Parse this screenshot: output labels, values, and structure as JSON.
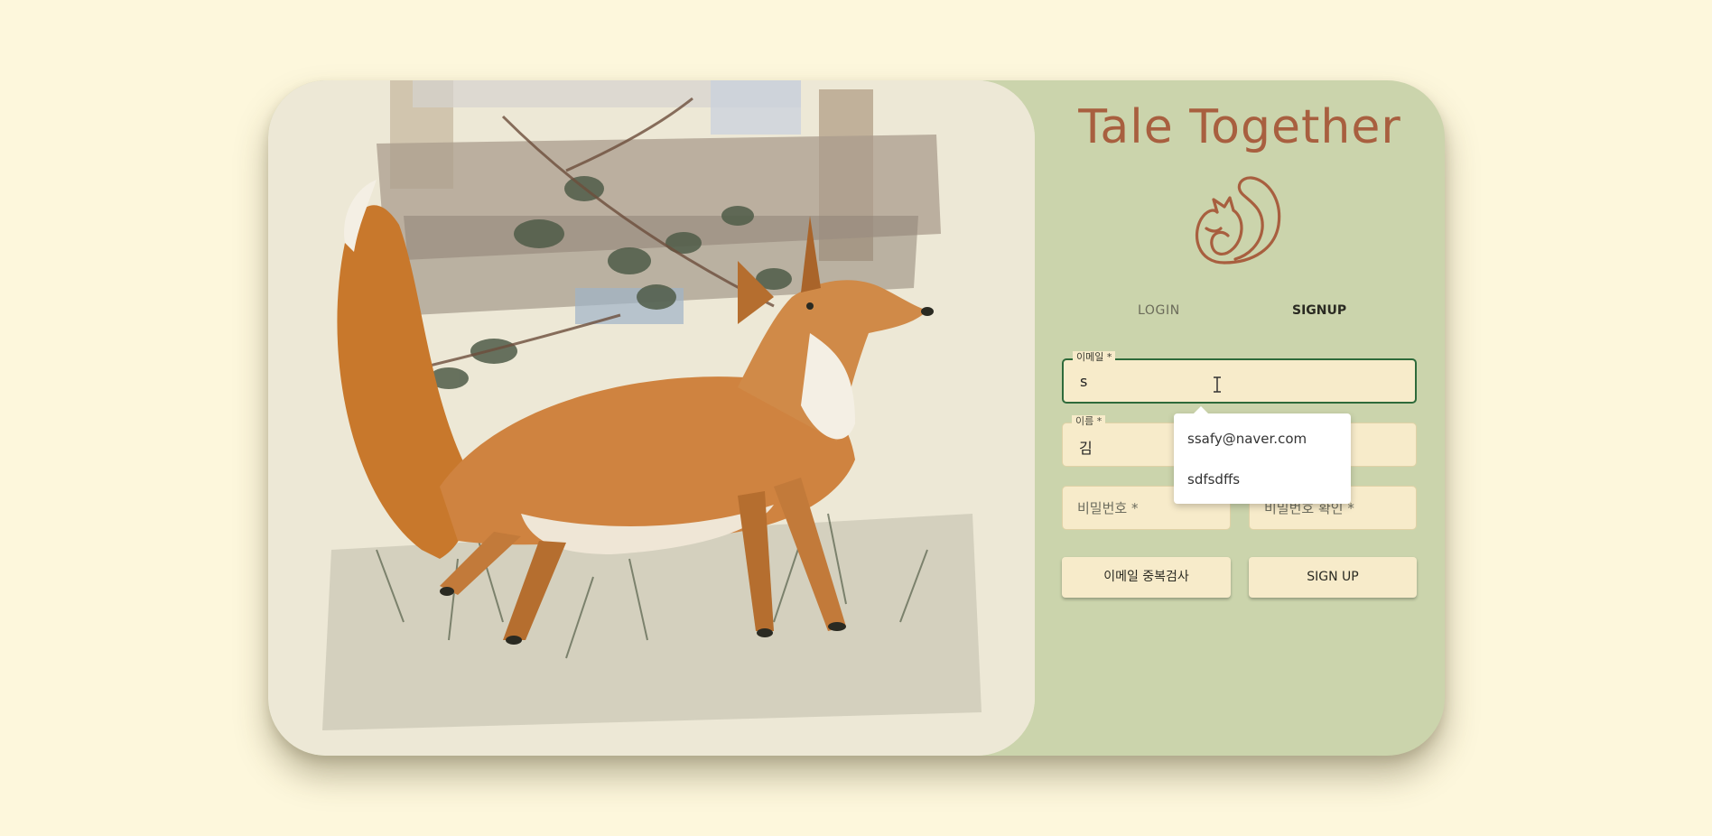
{
  "app": {
    "title": "Tale Together"
  },
  "logo": {
    "icon": "squirrel-logo-icon",
    "color": "#a85f3f"
  },
  "tabs": [
    {
      "label": "LOGIN",
      "active": false
    },
    {
      "label": "SIGNUP",
      "active": true
    }
  ],
  "form": {
    "email": {
      "label": "이메일 *",
      "value": "s"
    },
    "name": {
      "label": "이름 *",
      "value": "김"
    },
    "password": {
      "placeholder": "비밀번호 *"
    },
    "password_confirm": {
      "placeholder": "비밀번호 확인 *"
    }
  },
  "buttons": {
    "check_email": "이메일 중복검사",
    "signup": "SIGN UP"
  },
  "autocomplete": {
    "options": [
      "ssafy@naver.com",
      "sdfsdffs"
    ]
  },
  "colors": {
    "page_background": "#fdf7dc",
    "panel": "#cbd4ac",
    "title": "#a85f3f",
    "input_fill": "#f7ebca",
    "focus_border": "#2e6a3a"
  }
}
